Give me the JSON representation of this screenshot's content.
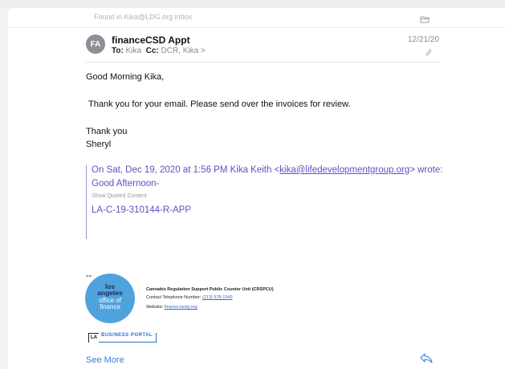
{
  "found_in": "Found in Kika@LDG.org inbox",
  "header": {
    "avatar_initials": "FA",
    "subject": "financeCSD Appt",
    "to_label": "To:",
    "to_value": "Kika",
    "cc_label": "Cc:",
    "cc_value": "DCR, Kika",
    "cc_chevron": ">",
    "date": "12/21/20"
  },
  "body": {
    "greeting": "Good Morning Kika,",
    "line1": "Thank you for your email. Please send over the invoices for review.",
    "thanks": "Thank you",
    "name": "Sheryl"
  },
  "quote": {
    "intro_prefix": "On Sat, Dec 19, 2020 at 1:56 PM Kika Keith <",
    "intro_email": "kika@lifedevelopmentgroup.org",
    "intro_suffix": "> wrote:",
    "line1": "Good Afternoon-",
    "show_quoted": "Show Quoted Content",
    "ref": "LA-C-19-310144-R-APP"
  },
  "signature": {
    "dashes": "--",
    "logo_line1": "los",
    "logo_line2": "angeles",
    "logo_line3": "office of",
    "logo_line4": "finance",
    "unit": "Cannabis Regulation Support Public Counter Unit (CRSPCU)",
    "phone_label": "Contact Telephone Number:",
    "phone": "(213) 978-1540",
    "website_label": "Website:",
    "website": "finance.lacity.org",
    "portal_la": "LA",
    "portal_text": "BUSINESS PORTAL"
  },
  "footer": {
    "see_more": "See More"
  },
  "icons": {
    "folder": "folder-icon",
    "attachment": "paperclip-icon",
    "reply": "reply-icon"
  },
  "colors": {
    "link": "#3b7cd8",
    "quote": "#5b50c4",
    "logo": "#4fa3dc",
    "avatar": "#8e8e96"
  }
}
